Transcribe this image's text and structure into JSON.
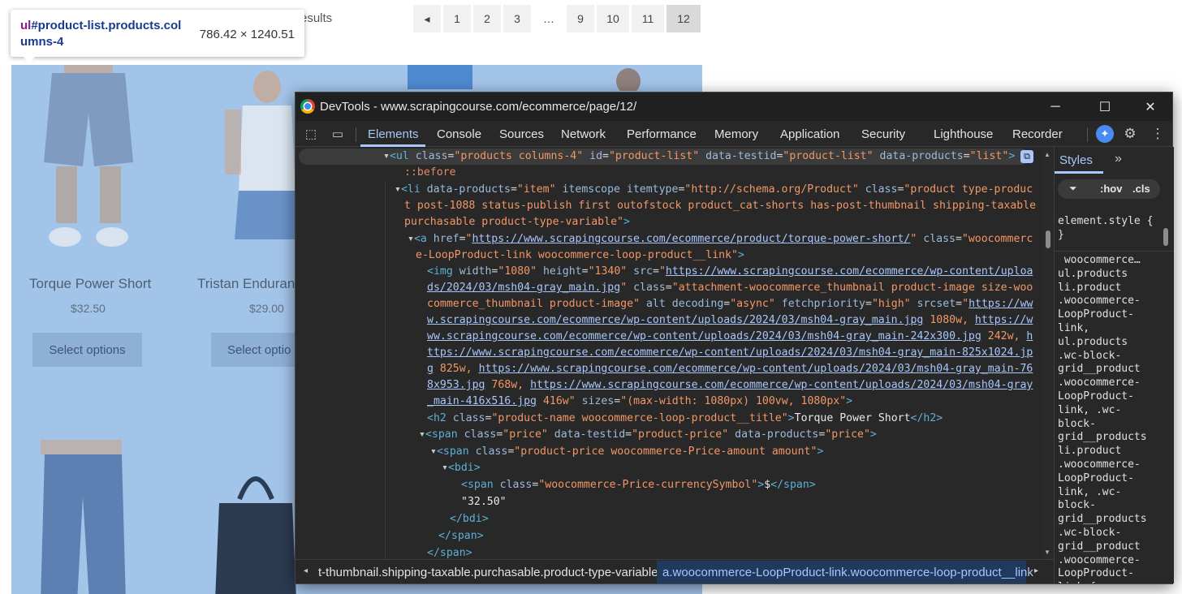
{
  "page": {
    "results_text": "esults",
    "pagination": [
      "1",
      "2",
      "3",
      "…",
      "9",
      "10",
      "11",
      "12"
    ],
    "current_page": "12",
    "products": [
      {
        "name": "Torque Power Short",
        "price": "$32.50",
        "button": "Select options"
      },
      {
        "name": "Tristan Enduranc",
        "price": "$29.00",
        "button": "Select optio"
      }
    ]
  },
  "tooltip": {
    "selector_tag": "ul",
    "selector_rest_line1": "#product-list.products.col",
    "selector_line2": "umns-4",
    "size": "786.42 × 1240.51"
  },
  "devtools": {
    "title": "DevTools - www.scrapingcourse.com/ecommerce/page/12/",
    "tabs": [
      "Elements",
      "Console",
      "Sources",
      "Network",
      "Performance",
      "Memory",
      "Application",
      "Security",
      "Lighthouse",
      "Recorder"
    ],
    "active_tab": "Elements",
    "styles": {
      "tab": "Styles",
      "hov": ":hov",
      "cls": ".cls",
      "element_style": "element.style {\n}",
      "selector": " woocommerce…\nul.products\nli.product\n.woocommerce-\nLoopProduct-\nlink,\nul.products\n.wc-block-\ngrid__product\n.woocommerce-\nLoopProduct-\nlink, .wc-\nblock-\ngrid__products\nli.product\n.woocommerce-\nLoopProduct-\nlink, .wc-\nblock-\ngrid__products\n.wc-block-\ngrid__product\n.woocommerce-\nLoopProduct-\nlink {"
    },
    "breadcrumbs": [
      "t-thumbnail.shipping-taxable.purchasable.product-type-variable",
      "a.woocommerce-LoopProduct-link.woocommerce-loop-product__link"
    ]
  }
}
